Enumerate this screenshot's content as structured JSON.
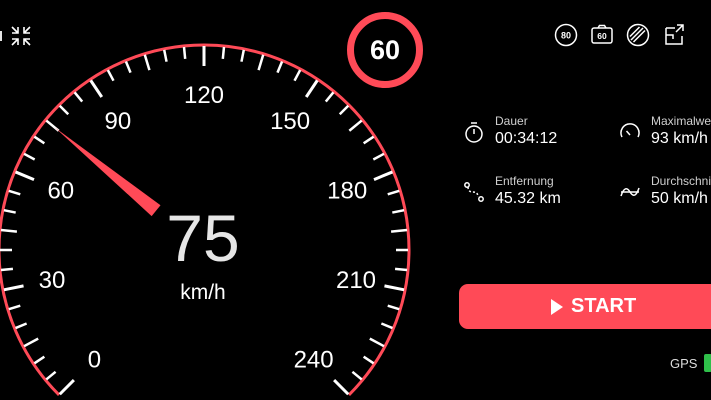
{
  "speedometer": {
    "speed": "75",
    "unit": "km/h",
    "scale_min": 0,
    "scale_max": 240,
    "scale_labels": [
      "0",
      "30",
      "60",
      "90",
      "120",
      "150",
      "180",
      "210",
      "240"
    ],
    "needle_value": 75,
    "accent_color": "#ff4a57"
  },
  "speed_limit": {
    "value": "60",
    "color": "#ff4a57"
  },
  "top_left_icons": [
    "truncated-icon",
    "exit-fullscreen-icon"
  ],
  "top_right_icons": [
    "speed-80-icon",
    "speed-60-icon",
    "no-speed-limit-icon",
    "export-icon"
  ],
  "top_icon_text": {
    "speed80": "80",
    "speed60": "60"
  },
  "stats": {
    "duration": {
      "label": "Dauer",
      "value": "00:34:12",
      "icon": "stopwatch-icon"
    },
    "max_speed": {
      "label": "Maximalwe",
      "value": "93 km/h",
      "icon": "gauge-icon"
    },
    "distance": {
      "label": "Entfernung",
      "value": "45.32 km",
      "icon": "route-icon"
    },
    "avg_speed": {
      "label": "Durchschni",
      "value": "50 km/h",
      "icon": "average-wave-icon"
    }
  },
  "start_button": {
    "label": "START",
    "icon": "play-icon"
  },
  "gps": {
    "label": "GPS",
    "status_color": "#2fbf4a"
  }
}
